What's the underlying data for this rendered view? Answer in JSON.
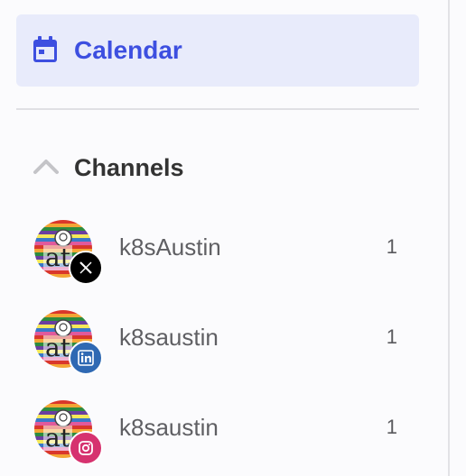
{
  "nav": {
    "calendar_label": "Calendar",
    "calendar_icon": "calendar-icon",
    "active_color": "#3d4fe0",
    "active_bg": "#e8ebfb"
  },
  "channels": {
    "title": "Channels",
    "expanded": true,
    "toggle_icon": "chevron-up-icon",
    "items": [
      {
        "name": "k8sAustin",
        "network": "x",
        "network_icon": "x-logo-icon",
        "count": "1",
        "avatar_text": "at"
      },
      {
        "name": "k8saustin",
        "network": "linkedin",
        "network_icon": "linkedin-logo-icon",
        "count": "1",
        "avatar_text": "at"
      },
      {
        "name": "k8saustin",
        "network": "instagram",
        "network_icon": "instagram-logo-icon",
        "count": "1",
        "avatar_text": "at"
      }
    ]
  }
}
